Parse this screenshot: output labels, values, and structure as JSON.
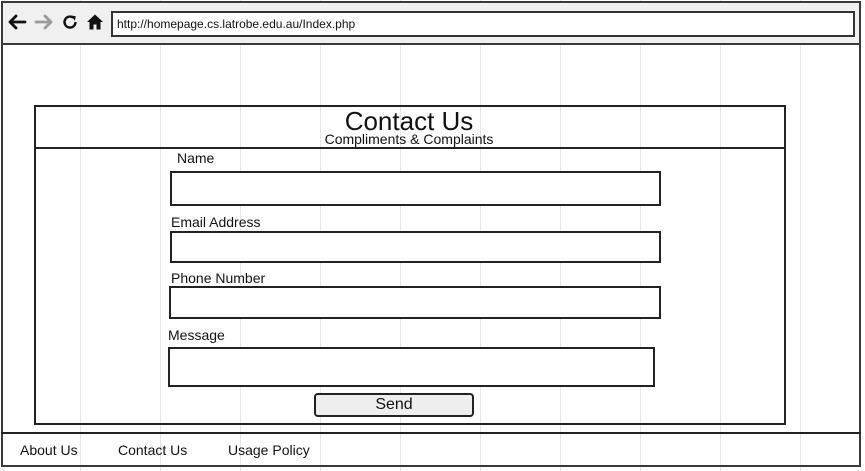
{
  "browser": {
    "url": "http://homepage.cs.latrobe.edu.au/Index.php",
    "buttons": [
      {
        "name": "back",
        "icon": "arrow-left-icon"
      },
      {
        "name": "forward",
        "icon": "arrow-right-icon"
      },
      {
        "name": "reload",
        "icon": "reload-icon"
      },
      {
        "name": "home",
        "icon": "home-icon"
      }
    ]
  },
  "page": {
    "title": "Contact Us",
    "subtitle": "Compliments & Complaints"
  },
  "form": {
    "name_label": "Name",
    "name_value": "",
    "email_label": "Email Address",
    "email_value": "",
    "phone_label": "Phone Number",
    "phone_value": "",
    "message_label": "Message",
    "message_value": "",
    "send_label": "Send"
  },
  "footer": {
    "links": [
      "About Us",
      "Contact Us",
      "Usage Policy"
    ]
  },
  "colors": {
    "border": "#222222",
    "browser_bar": "#f0f0f0",
    "forward_disabled": "#9a9a9a"
  }
}
